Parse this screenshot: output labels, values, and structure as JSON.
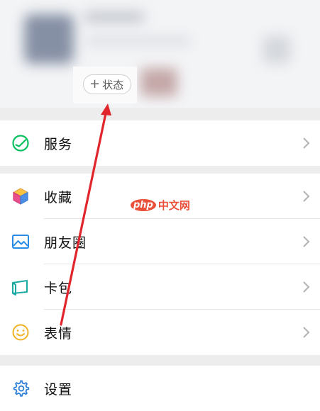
{
  "profile": {
    "status_button_label": "状态",
    "status_plus": "+"
  },
  "menu": {
    "services": {
      "label": "服务",
      "icon": "services-icon"
    },
    "favorites": {
      "label": "收藏",
      "icon": "favorites-cube-icon"
    },
    "moments": {
      "label": "朋友圈",
      "icon": "moments-image-icon"
    },
    "cards": {
      "label": "卡包",
      "icon": "card-wallet-icon"
    },
    "stickers": {
      "label": "表情",
      "icon": "smiley-icon"
    },
    "settings": {
      "label": "设置",
      "icon": "gear-icon"
    }
  },
  "watermark": {
    "logo_text": "php",
    "site_text": "中文网"
  },
  "colors": {
    "services_green": "#07c160",
    "moments_blue": "#2a8de5",
    "cards_teal": "#1ba9a3",
    "stickers_yellow": "#f0b323",
    "settings_blue": "#2f7fd8",
    "annotation_red": "#e0262c",
    "chevron_gray": "#b2b2b2"
  }
}
